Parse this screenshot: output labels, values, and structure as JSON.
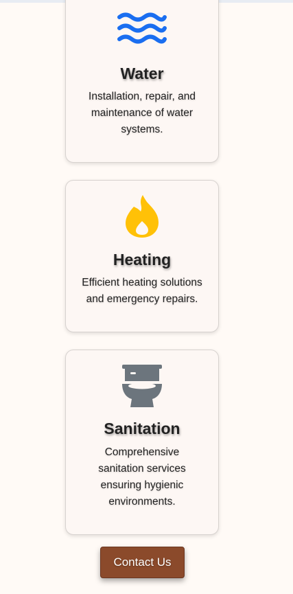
{
  "services": [
    {
      "icon": "water-waves-icon",
      "icon_color": "#1a6ef0",
      "title": "Water",
      "description": "Installation, repair, and maintenance of water systems."
    },
    {
      "icon": "flame-icon",
      "icon_color": "#ffc107",
      "title": "Heating",
      "description": "Efficient heating solutions and emergency repairs."
    },
    {
      "icon": "toilet-icon",
      "icon_color": "#6c757d",
      "title": "Sanitation",
      "description": "Comprehensive sanitation services ensuring hygienic environments."
    }
  ],
  "contact_button": {
    "label": "Contact Us",
    "background": "#8b4a2b"
  }
}
